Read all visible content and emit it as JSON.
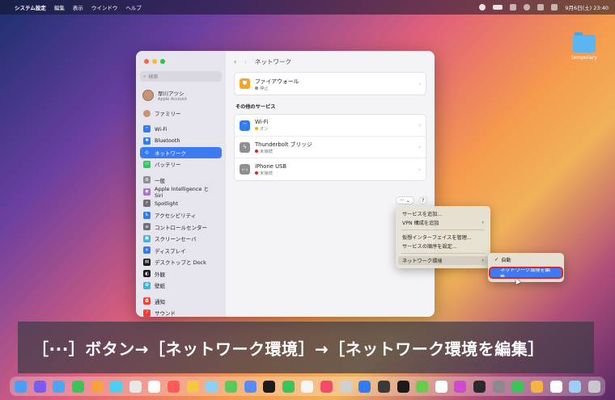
{
  "menubar": {
    "apple": "",
    "items": [
      "システム設定",
      "編集",
      "表示",
      "ウインドウ",
      "ヘルプ"
    ],
    "clock": "9月6日(土) 23:40"
  },
  "desktop": {
    "folder_label": "temporary"
  },
  "sidebar": {
    "search_placeholder": "検索",
    "user": {
      "name": "早川アツシ",
      "sub": "Apple Account"
    },
    "family": "ファミリー",
    "items": [
      {
        "label": "Wi-Fi",
        "color": "#2f7cf6",
        "glyph": "⌔"
      },
      {
        "label": "Bluetooth",
        "color": "#2f7cf6",
        "glyph": "✱"
      },
      {
        "label": "ネットワーク",
        "color": "#2f7cf6",
        "glyph": "◎",
        "selected": true
      },
      {
        "label": "バッテリー",
        "color": "#34c759",
        "glyph": "▭"
      },
      {
        "label": "一般",
        "color": "#8e8e93",
        "glyph": "⚙",
        "gap": true
      },
      {
        "label": "Apple Intelligence と Siri",
        "color": "#b86ad6",
        "glyph": "◉"
      },
      {
        "label": "Spotlight",
        "color": "#6e6e73",
        "glyph": "⌕"
      },
      {
        "label": "アクセシビリティ",
        "color": "#2f7cf6",
        "glyph": "♿"
      },
      {
        "label": "コントロールセンター",
        "color": "#6e6e73",
        "glyph": "≡"
      },
      {
        "label": "スクリーンセーバ",
        "color": "#36b7e8",
        "glyph": "▣"
      },
      {
        "label": "ディスプレイ",
        "color": "#2f7cf6",
        "glyph": "☀"
      },
      {
        "label": "デスクトップと Dock",
        "color": "#1c1c1e",
        "glyph": "▤"
      },
      {
        "label": "外観",
        "color": "#1c1c1e",
        "glyph": "◐"
      },
      {
        "label": "壁紙",
        "color": "#36b7e8",
        "glyph": "✿"
      },
      {
        "label": "通知",
        "color": "#ff3b30",
        "glyph": "◘",
        "gap": true
      },
      {
        "label": "サウンド",
        "color": "#ff3b30",
        "glyph": "♪"
      }
    ]
  },
  "main": {
    "title": "ネットワーク",
    "firewall": {
      "title": "ファイアウォール",
      "status": "停止",
      "status_color": "#8e8e93"
    },
    "section": "その他のサービス",
    "services": [
      {
        "title": "Wi-Fi",
        "status": "オン",
        "status_color": "#f5b400",
        "color": "#2f7cf6",
        "glyph": "⌔"
      },
      {
        "title": "Thunderbolt ブリッジ",
        "status": "未接続",
        "status_color": "#e0242a",
        "color": "#8e8e93",
        "glyph": "ϟ"
      },
      {
        "title": "iPhone USB",
        "status": "未接続",
        "status_color": "#e0242a",
        "color": "#8e8e93",
        "glyph": "‹·›"
      }
    ],
    "more_button": "···",
    "help_button": "?"
  },
  "menu": {
    "items": [
      "サービスを追加...",
      "VPN 構成を追加",
      "仮想インターフェイスを管理...",
      "サービスの順序を設定...",
      "ネットワーク環境"
    ],
    "submenu": [
      "自動",
      "ネットワーク環境を編集..."
    ]
  },
  "caption": "［···］ボタン→［ネットワーク環境］→［ネットワーク環境を編集］",
  "dock": {
    "apps": [
      "#4a9ef5",
      "#7a5cf0",
      "#4aa5f5",
      "#3bc45a",
      "#f6a13a",
      "#4ad0f0",
      "#e8e8e8",
      "#ffffff",
      "#ff5a5a",
      "#f5c842",
      "#8bd0f5",
      "#5ac85a",
      "#5a8af5",
      "#1c1c1e",
      "#3bc45a",
      "#f5f5f5",
      "#f54a6a",
      "#d0d0d0",
      "#2f7cf6",
      "#3a3a3c",
      "#1a1a1a",
      "#6acb4a",
      "#ffffff",
      "#d04ad0",
      "#2a2a2a",
      "#8a8a8a",
      "#3bc45a",
      "#f5b442",
      "#ffffff",
      "#9ad0f5",
      "#c8c8cc"
    ]
  }
}
